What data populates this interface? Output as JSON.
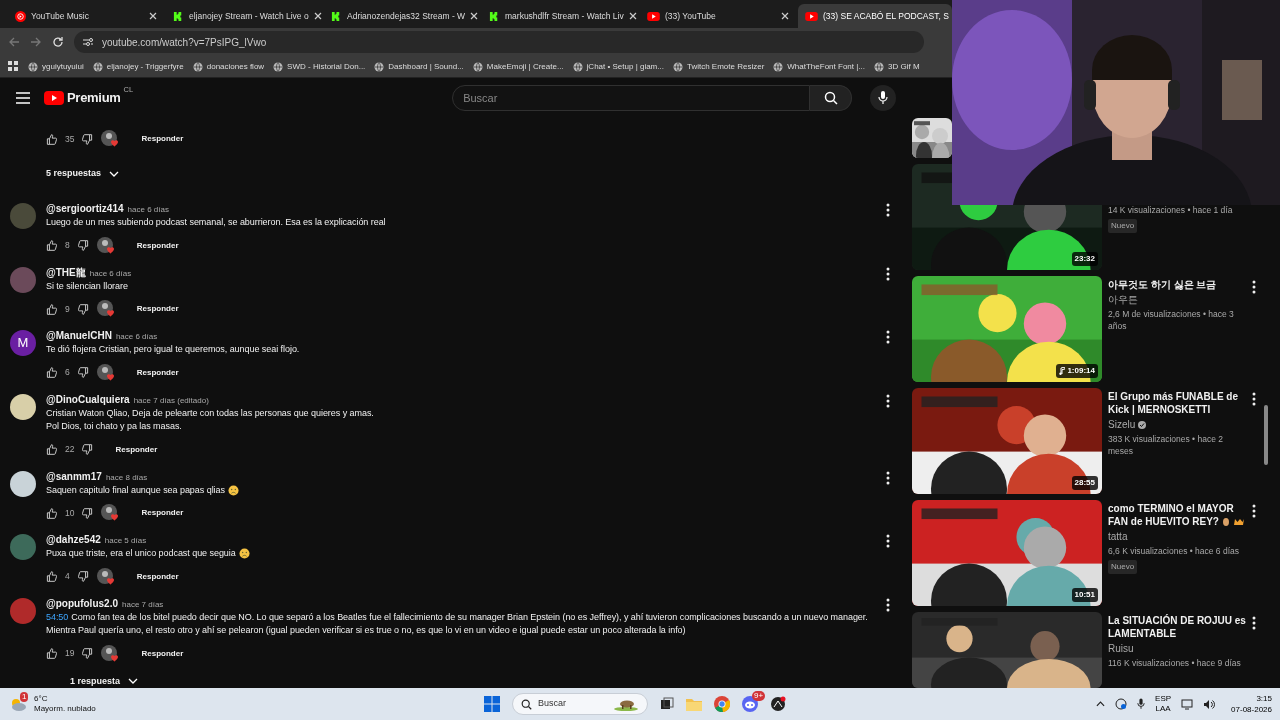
{
  "browser": {
    "tabs": [
      {
        "title": "YouTube Music",
        "kind": "youtube_music",
        "selected": false
      },
      {
        "title": "eljanojey Stream - Watch Live o",
        "kind": "kick",
        "selected": false
      },
      {
        "title": "Adrianozendejas32 Stream - W",
        "kind": "kick",
        "selected": false
      },
      {
        "title": "markushdlfr Stream - Watch Liv",
        "kind": "kick",
        "selected": false
      },
      {
        "title": "(33) YouTube",
        "kind": "youtube",
        "selected": false
      },
      {
        "title": "(33) SE ACABÓ EL PODCAST, S",
        "kind": "youtube",
        "selected": true
      }
    ],
    "address": "youtube.com/watch?v=7PsIPG_lVwo",
    "bookmarks": [
      "yguiytuyuiui",
      "eljanojey - Triggerfyre",
      "donaciones flow",
      "SWD - Historial Don...",
      "Dashboard | Sound...",
      "MakeEmoji | Create...",
      "jChat • Setup | giam...",
      "Twitch Emote Resizer",
      "WhatTheFont Font |...",
      "3D Gif M"
    ]
  },
  "header": {
    "logo": "Premium",
    "region": "CL",
    "search_placeholder": "Buscar"
  },
  "comments": {
    "thread": {
      "likes": "35",
      "hearted": true,
      "reply_label": "Responder",
      "replies_toggle": "5 respuestas"
    },
    "items": [
      {
        "handle": "@sergioortiz414",
        "time": "hace 6 días",
        "lines": [
          "Luego de un mes subiendo podcast semanal, se aburrieron. Esa es la explicación real"
        ],
        "likes": "8",
        "hearted": true,
        "reply_label": "Responder",
        "avatar": {
          "kind": "picture",
          "color": "#4a4a3a"
        }
      },
      {
        "handle": "@THE龍",
        "time": "hace 6 días",
        "lines": [
          "Si te silencian llorare"
        ],
        "likes": "9",
        "hearted": true,
        "reply_label": "Responder",
        "avatar": {
          "kind": "picture",
          "color": "#6b4a5a"
        }
      },
      {
        "handle": "@ManuelCHN",
        "time": "hace 6 días",
        "lines": [
          "Te dió flojera Cristian, pero igual te queremos, aunque seai flojo."
        ],
        "likes": "6",
        "hearted": true,
        "reply_label": "Responder",
        "avatar": {
          "kind": "letter",
          "letter": "M",
          "color": "#6a1fa2"
        }
      },
      {
        "handle": "@DinoCualquiera",
        "time": "hace 7 días (editado)",
        "lines": [
          "Cristian Waton Qliao, Deja de pelearte con todas las personas que quieres y amas.",
          "Pol Dios, toi chato y pa las masas."
        ],
        "likes": "22",
        "hearted": false,
        "reply_label": "Responder",
        "avatar": {
          "kind": "picture",
          "color": "#d8cfa8"
        }
      },
      {
        "handle": "@sanmm17",
        "time": "hace 8 días",
        "lines": [
          "Saquen capitulo final aunque sea papas qlias"
        ],
        "sad_emoji": true,
        "likes": "10",
        "hearted": true,
        "reply_label": "Responder",
        "avatar": {
          "kind": "picture",
          "color": "#c9d3d8"
        }
      },
      {
        "handle": "@dahze542",
        "time": "hace 5 días",
        "lines": [
          "Puxa que triste, era el unico podcast que seguia"
        ],
        "sad_emoji": true,
        "likes": "4",
        "hearted": true,
        "reply_label": "Responder",
        "avatar": {
          "kind": "picture",
          "color": "#3d6a5a"
        }
      },
      {
        "handle": "@popufolus2.0",
        "time": "hace 7 días",
        "timestamp": "54:50",
        "lines": [
          "Como fan tea de los bitel puedo decir que NO. Lo que separó a los Beatles fue el fallecimiento de su manager Brian Epstein (no es Jeffrey), y ahí tuvieron complicaciones buscando a un nuevo manager.",
          "Mientra Paul quería uno, el resto otro y ahí se pelearon (igual pueden verificar si es true o no, es que lo vi en un video e igual puede estar un poco alterada la info)"
        ],
        "likes": "19",
        "hearted": true,
        "reply_label": "Responder",
        "avatar": {
          "kind": "picture",
          "color": "#b02a2a"
        }
      }
    ],
    "more_replies": "1 respuesta"
  },
  "sidebar": [
    {
      "kind": "picture"
    },
    {
      "duration": "23:32",
      "meta": "14 K visualizaciones • hace 1 día",
      "badge": "Nuevo"
    },
    {
      "title": "아무것도 하기 싫은 브금",
      "channel": "아우튼",
      "meta": "2,6 M de visualizaciones • hace 3 años",
      "duration": "1:09:14",
      "music": true
    },
    {
      "title": "El Grupo más FUNABLE de Kick | MERNOSKETTI",
      "channel": "Sizelu",
      "verified": true,
      "meta": "383 K visualizaciones • hace 2 meses",
      "duration": "28:55"
    },
    {
      "title": "como TERMINO el MAYOR FAN de HUEVITO REY?",
      "title_emoji": true,
      "channel": "tatta",
      "meta": "6,6 K visualizaciones • hace 6 días",
      "badge": "Nuevo",
      "duration": "10:51"
    },
    {
      "title": "La SITUACIÓN DE ROJUU es LAMENTABLE",
      "channel": "Ruisu",
      "meta": "116 K visualizaciones • hace 9 días"
    }
  ],
  "taskbar": {
    "weather_badge": "1",
    "temperature": "6°C",
    "weather": "Mayorm. nublado",
    "search_placeholder": "Buscar",
    "discord_badge": "9+",
    "language": "ESP",
    "layout": "LAA",
    "time": "3:15",
    "date": "07-08-2026"
  }
}
